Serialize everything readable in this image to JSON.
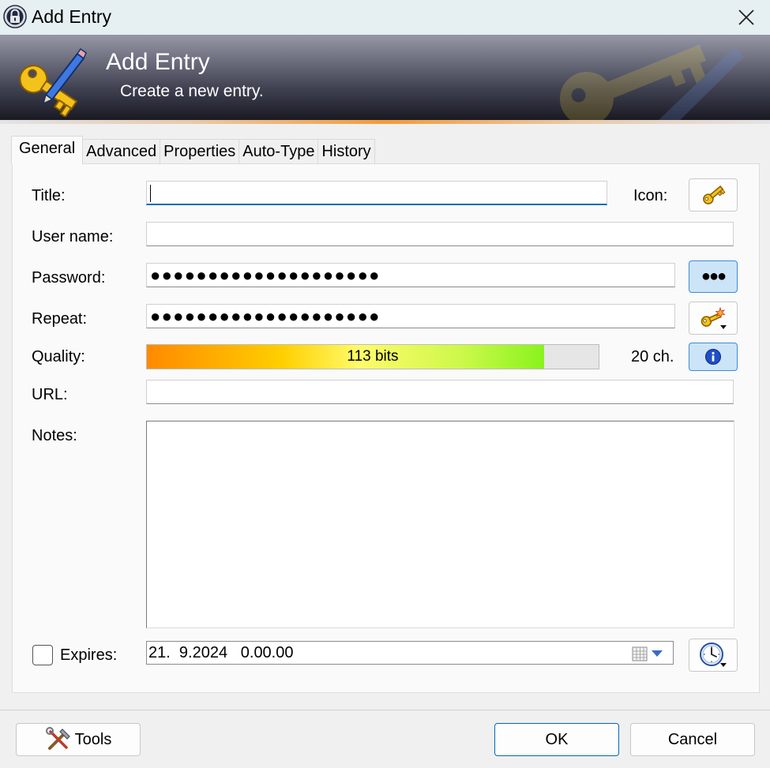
{
  "window": {
    "title": "Add Entry",
    "close_glyph": "✕"
  },
  "banner": {
    "title": "Add Entry",
    "subtitle": "Create a new entry."
  },
  "tabs": [
    {
      "label": "General",
      "active": true
    },
    {
      "label": "Advanced"
    },
    {
      "label": "Properties"
    },
    {
      "label": "Auto-Type"
    },
    {
      "label": "History"
    }
  ],
  "form": {
    "title_label": "Title:",
    "title_value": "",
    "icon_label": "Icon:",
    "username_label": "User name:",
    "username_value": "",
    "password_label": "Password:",
    "password_masked": "●●●●●●●●●●●●●●●●●●●●",
    "repeat_label": "Repeat:",
    "repeat_masked": "●●●●●●●●●●●●●●●●●●●●",
    "hide_password_glyph": "●●●",
    "quality_label": "Quality:",
    "quality_text": "113 bits",
    "quality_fraction": 0.88,
    "char_count": "20 ch.",
    "url_label": "URL:",
    "url_value": "",
    "notes_label": "Notes:",
    "notes_value": "",
    "expires_label": "Expires:",
    "expires_checked": false,
    "expires_value": "21.  9.2024   0.00.00"
  },
  "footer": {
    "tools_label": "Tools",
    "ok_label": "OK",
    "cancel_label": "Cancel"
  },
  "colors": {
    "accent": "#0067c0",
    "toggled_bg": "#cce4f7",
    "banner_dark": "#16161e",
    "stripe_orange": "#f39a3a"
  },
  "icons": [
    "keepass-lock-icon",
    "close-icon",
    "key-pencil-icon",
    "key-icon",
    "hide-password-icon",
    "generate-password-icon",
    "info-icon",
    "calendar-icon",
    "dropdown-arrow-icon",
    "clock-icon",
    "tools-icon"
  ]
}
